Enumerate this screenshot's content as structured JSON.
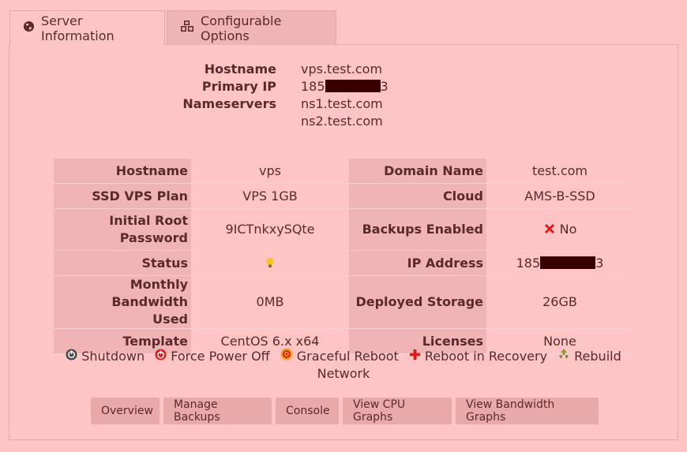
{
  "tabs": [
    {
      "label": "Server Information",
      "icon": "globe-icon"
    },
    {
      "label": "Configurable Options",
      "icon": "cubes-icon"
    }
  ],
  "summary": {
    "hostname_label": "Hostname",
    "hostname": "vps.test.com",
    "primary_ip_label": "Primary IP",
    "primary_ip_prefix": "185",
    "primary_ip_suffix": "3",
    "nameservers_label": "Nameservers",
    "ns1": "ns1.test.com",
    "ns2": "ns2.test.com"
  },
  "details": {
    "hostname_label": "Hostname",
    "hostname": "vps",
    "domain_label": "Domain Name",
    "domain": "test.com",
    "plan_label": "SSD VPS Plan",
    "plan": "VPS 1GB",
    "cloud_label": "Cloud",
    "cloud": "AMS-B-SSD",
    "root_pw_label_1": "Initial Root",
    "root_pw_label_2": "Password",
    "root_pw": "9ICTnkxySQte",
    "backups_label": "Backups Enabled",
    "backups": "No",
    "status_label": "Status",
    "ip_label": "IP Address",
    "ip_prefix": "185",
    "ip_suffix": "3",
    "bandwidth_label_1": "Monthly Bandwidth",
    "bandwidth_label_2": "Used",
    "bandwidth": "0MB",
    "storage_label": "Deployed Storage",
    "storage": "26GB",
    "template_label": "Template",
    "template": "CentOS 6.x x64",
    "licenses_label": "Licenses",
    "licenses": "None"
  },
  "actions": {
    "shutdown": "Shutdown",
    "force_off": "Force Power Off",
    "graceful_reboot": "Graceful Reboot",
    "reboot_recovery": "Reboot in Recovery",
    "rebuild_1": "Rebuild",
    "rebuild_2": "Network"
  },
  "buttons": {
    "overview": "Overview",
    "manage_backups": "Manage Backups",
    "console": "Console",
    "cpu_graphs": "View CPU Graphs",
    "bandwidth_graphs": "View Bandwidth Graphs"
  },
  "colors": {
    "background": "#ffc4c4",
    "label_cell": "#f1b4b4",
    "button": "#e9a9a9",
    "text": "#5a2a2a",
    "redaction": "#3a0000",
    "no_icon": "#e0161a"
  }
}
